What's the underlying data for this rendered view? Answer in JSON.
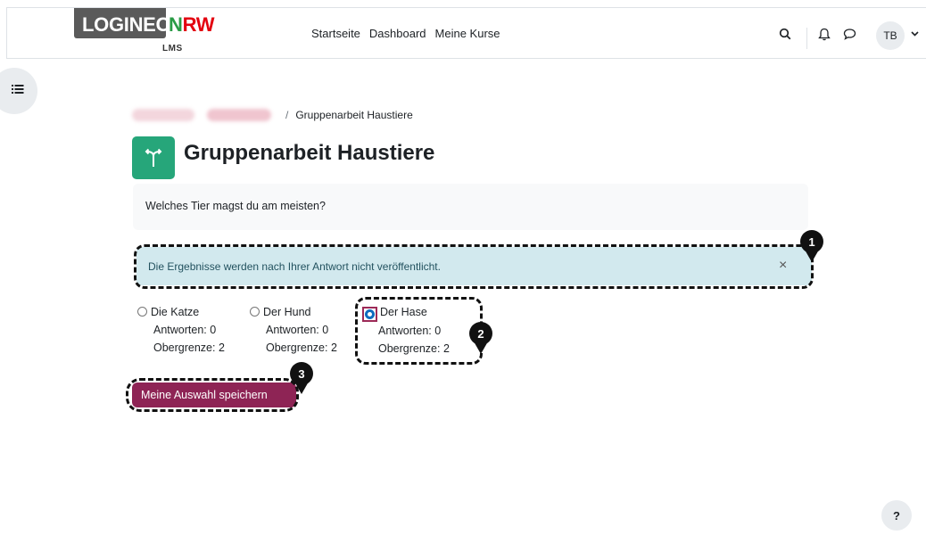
{
  "logo": {
    "part1": "LOGINEO",
    "part2_green": "N",
    "part2_red": "RW",
    "sub": "LMS"
  },
  "nav": {
    "links": [
      "Startseite",
      "Dashboard",
      "Meine Kurse"
    ],
    "avatar_initials": "TB"
  },
  "icons": {
    "search": "search-icon",
    "bell": "bell-icon",
    "chat": "chat-icon",
    "chevron": "chevron-down-icon",
    "drawer": "list-icon",
    "activity": "choice-icon",
    "close": "close-icon"
  },
  "breadcrumb": {
    "current": "Gruppenarbeit Haustiere"
  },
  "page": {
    "title": "Gruppenarbeit Haustiere",
    "question": "Welches Tier magst du am meisten?"
  },
  "alert": {
    "text": "Die Ergebnisse werden nach Ihrer Antwort nicht veröffentlicht.",
    "close": "×"
  },
  "options": [
    {
      "label": "Die Katze",
      "answers": "Antworten: 0",
      "limit": "Obergrenze: 2",
      "selected": false
    },
    {
      "label": "Der Hund",
      "answers": "Antworten: 0",
      "limit": "Obergrenze: 2",
      "selected": false
    },
    {
      "label": "Der Hase",
      "answers": "Antworten: 0",
      "limit": "Obergrenze: 2",
      "selected": true
    }
  ],
  "save_button": "Meine Auswahl speichern",
  "markers": [
    "1",
    "2",
    "3"
  ],
  "help": "?",
  "colors": {
    "accent": "#8e2455",
    "alert_bg": "#d2e9ee",
    "activity_icon": "#26a67a",
    "radio_checked": "#0f6cbf"
  }
}
